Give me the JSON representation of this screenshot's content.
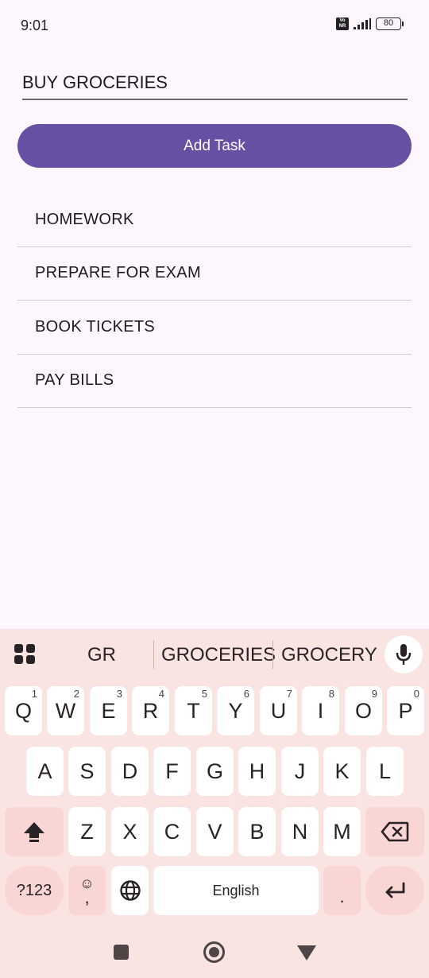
{
  "status_bar": {
    "time": "9:01",
    "volte": "Vo NR",
    "battery": "80"
  },
  "input": {
    "value": "BUY GROCERIES"
  },
  "add_button": {
    "label": "Add Task"
  },
  "tasks": [
    "HOMEWORK",
    "PREPARE FOR EXAM",
    "BOOK TICKETS",
    "PAY BILLS"
  ],
  "keyboard": {
    "suggestions": [
      "GR",
      "GROCERIES",
      "GROCERY"
    ],
    "row1": [
      {
        "k": "Q",
        "h": "1"
      },
      {
        "k": "W",
        "h": "2"
      },
      {
        "k": "E",
        "h": "3"
      },
      {
        "k": "R",
        "h": "4"
      },
      {
        "k": "T",
        "h": "5"
      },
      {
        "k": "Y",
        "h": "6"
      },
      {
        "k": "U",
        "h": "7"
      },
      {
        "k": "I",
        "h": "8"
      },
      {
        "k": "O",
        "h": "9"
      },
      {
        "k": "P",
        "h": "0"
      }
    ],
    "row2": [
      "A",
      "S",
      "D",
      "F",
      "G",
      "H",
      "J",
      "K",
      "L"
    ],
    "row3": [
      "Z",
      "X",
      "C",
      "V",
      "B",
      "N",
      "M"
    ],
    "symbols_label": "?123",
    "emoji_label": "☺",
    "comma_label": ",",
    "space_label": "English",
    "period_label": ".",
    "colors": {
      "background": "#f9e4e1",
      "key": "#ffffff",
      "function_key": "#f9d6d3"
    }
  },
  "colors": {
    "accent": "#6750a4",
    "background": "#fdf7fd",
    "divider": "#cfc9d1"
  },
  "icons": [
    "volte-icon",
    "signal-icon",
    "battery-icon",
    "apps-grid-icon",
    "mic-icon",
    "shift-icon",
    "backspace-icon",
    "globe-icon",
    "enter-icon",
    "recents-icon",
    "home-icon",
    "back-icon"
  ]
}
